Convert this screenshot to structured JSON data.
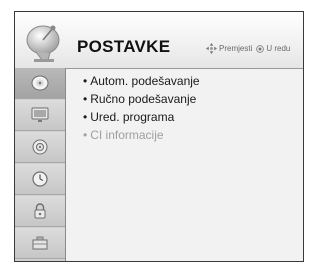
{
  "header": {
    "title": "POSTAVKE",
    "move_hint": "Premjesti",
    "ok_hint": "U redu",
    "icon": "satellite-dish-icon"
  },
  "sidebar": {
    "tabs": [
      {
        "icon": "satellite-dish-icon",
        "active": true
      },
      {
        "icon": "monitor-icon",
        "active": false
      },
      {
        "icon": "speaker-icon",
        "active": false
      },
      {
        "icon": "clock-icon",
        "active": false
      },
      {
        "icon": "lock-icon",
        "active": false
      },
      {
        "icon": "options-icon",
        "active": false
      }
    ]
  },
  "menu": {
    "bullet": "•",
    "items": [
      {
        "label": "Autom. podešavanje",
        "enabled": true
      },
      {
        "label": "Ručno podešavanje",
        "enabled": true
      },
      {
        "label": "Ured. programa",
        "enabled": true
      },
      {
        "label": "CI informacije",
        "enabled": false
      }
    ]
  },
  "colors": {
    "text": "#1a1a1a",
    "disabled_text": "#a0a0a0",
    "sidebar_bg": "#cfcfcf",
    "active_tab": "#a3a3a3"
  }
}
